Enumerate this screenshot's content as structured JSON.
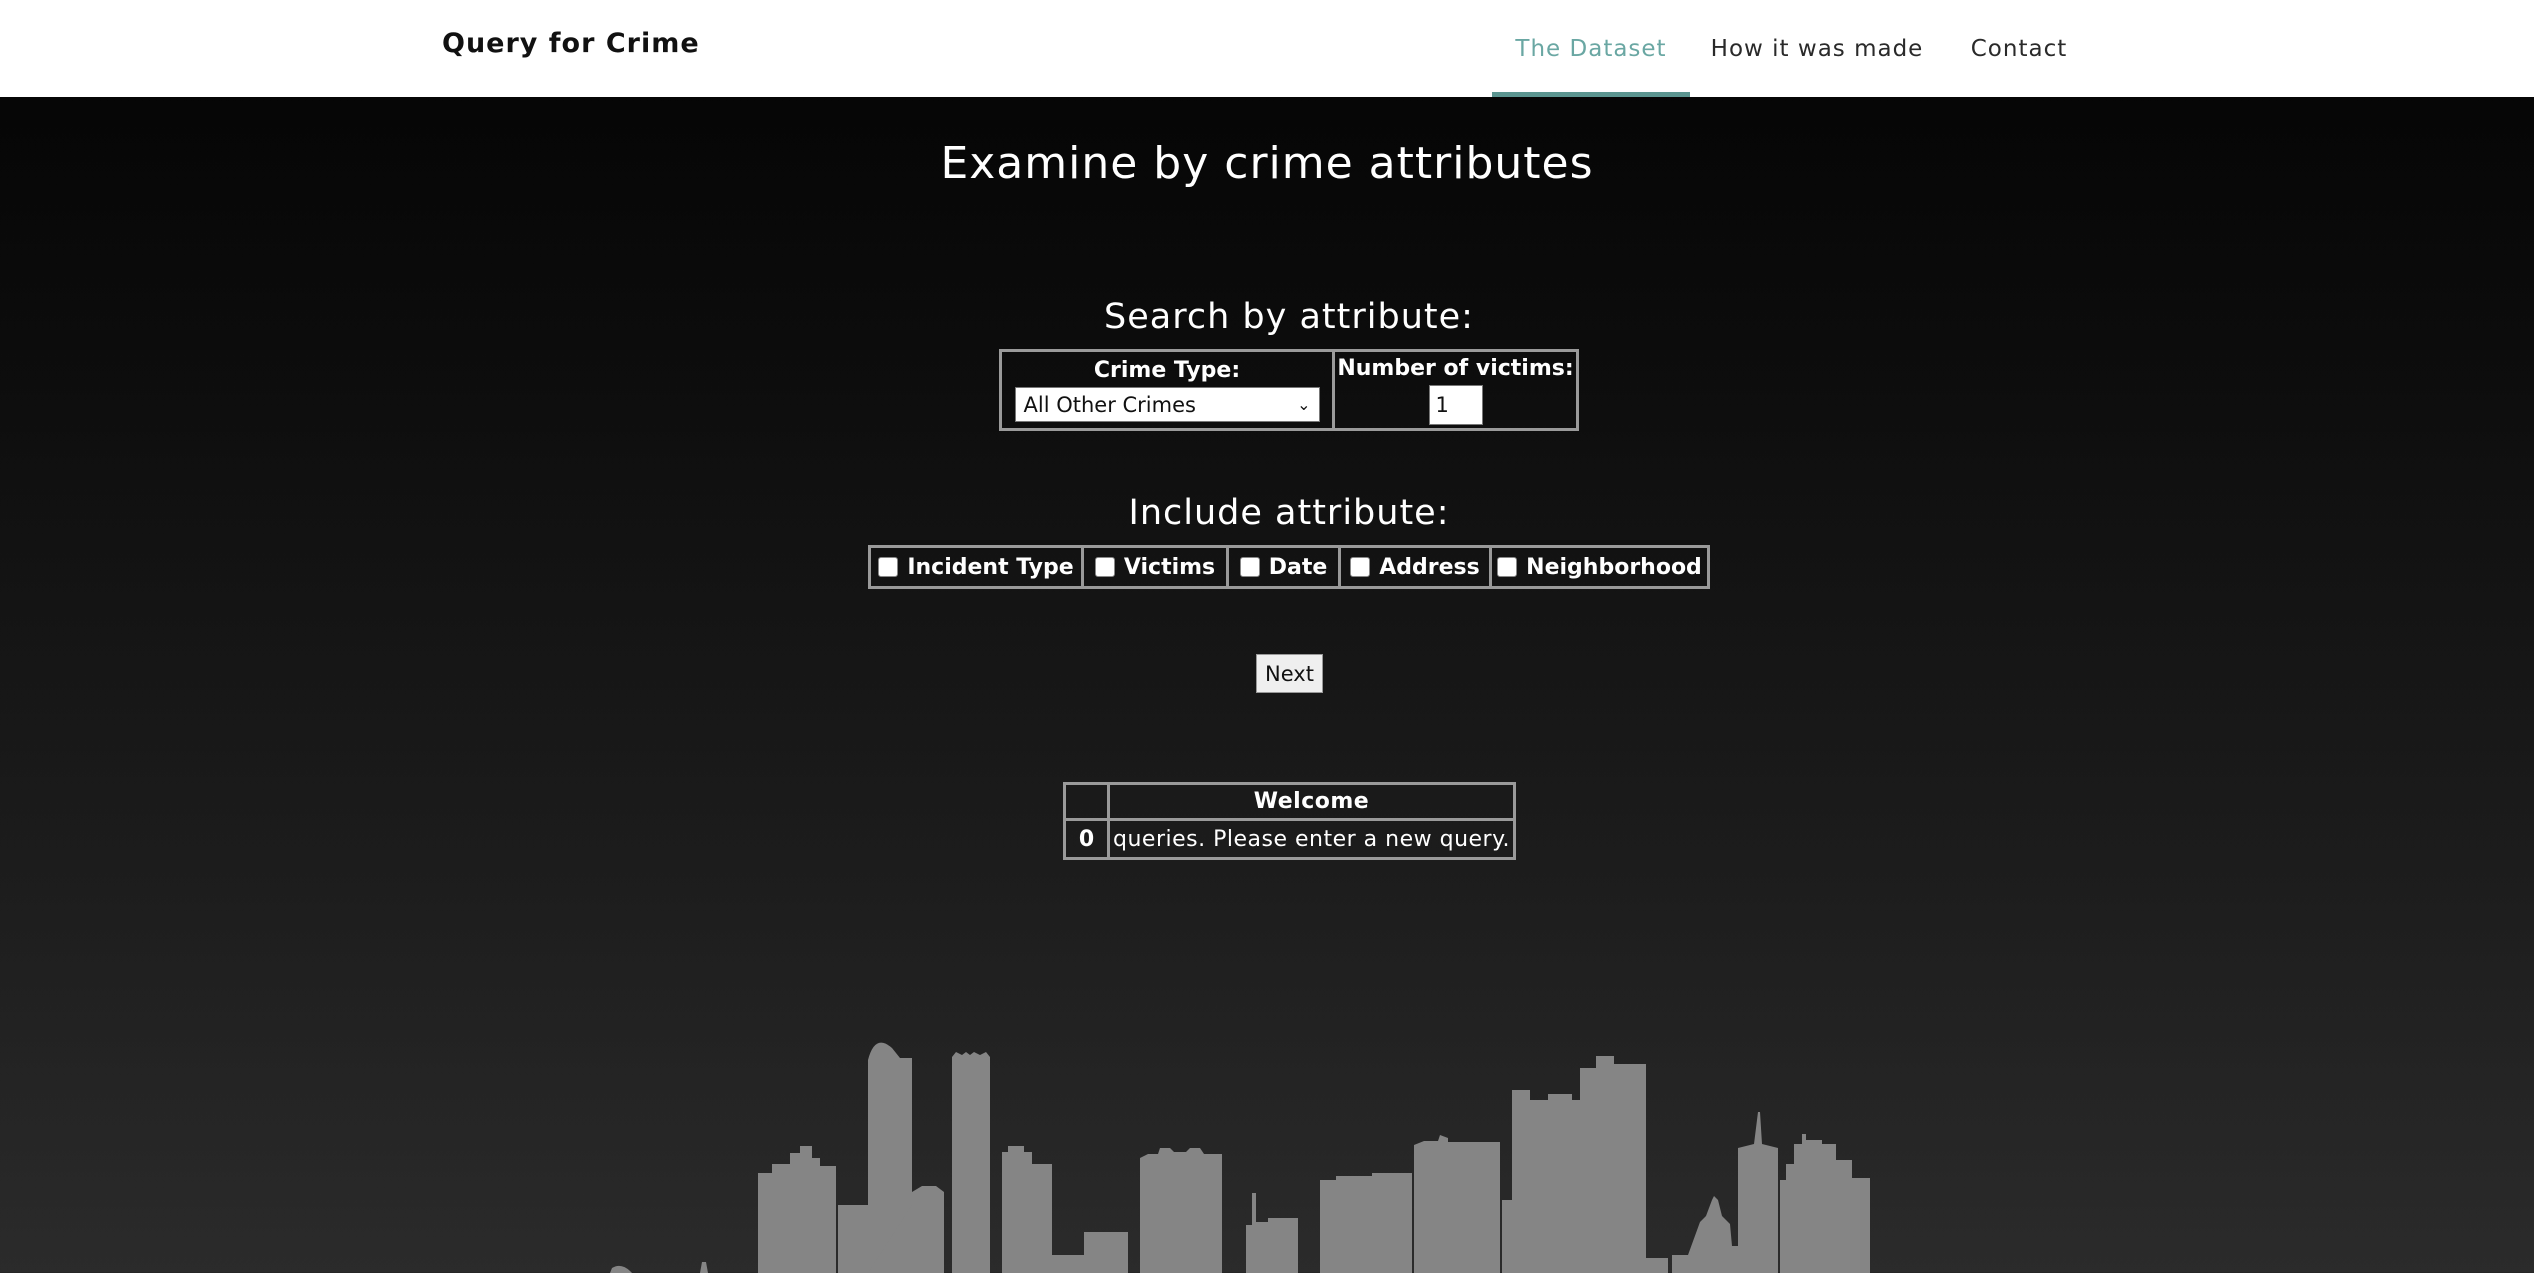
{
  "nav": {
    "brand": "Query for Crime",
    "links": [
      "The Dataset",
      "How it was made",
      "Contact"
    ],
    "active_index": 0,
    "accent_color": "#6aa7a3"
  },
  "page": {
    "title": "Examine by crime attributes"
  },
  "search": {
    "title": "Search by attribute:",
    "crime_type_label": "Crime Type:",
    "crime_type_value": "All Other Crimes",
    "victims_label": "Number of victims:",
    "victims_value": "1"
  },
  "include": {
    "title": "Include attribute:",
    "options": [
      "Incident Type",
      "Victims",
      "Date",
      "Address",
      "Neighborhood"
    ]
  },
  "next_label": "Next",
  "results": {
    "header": "Welcome",
    "row_index": "0",
    "row_text": "queries. Please enter a new query."
  },
  "colors": {
    "skyline": "#858585",
    "border": "#9a9a9a"
  }
}
